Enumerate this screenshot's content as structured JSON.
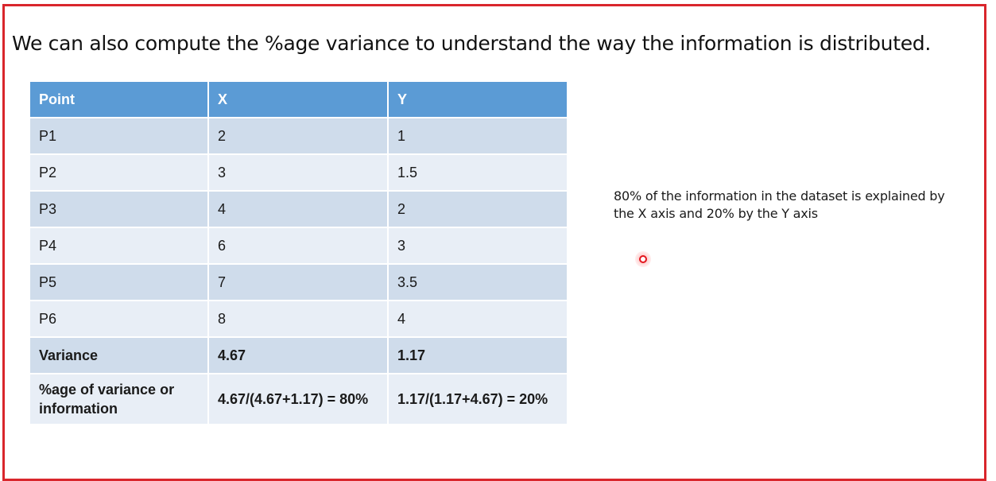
{
  "headline": "We can also compute the %age variance to understand the way the information is distributed.",
  "table": {
    "headers": [
      "Point",
      "X",
      "Y"
    ],
    "rows": [
      [
        "P1",
        "2",
        "1"
      ],
      [
        "P2",
        "3",
        "1.5"
      ],
      [
        "P3",
        "4",
        "2"
      ],
      [
        "P4",
        "6",
        "3"
      ],
      [
        "P5",
        "7",
        "3.5"
      ],
      [
        "P6",
        "8",
        "4"
      ],
      [
        "Variance",
        "4.67",
        "1.17"
      ],
      [
        "%age of variance or information",
        "4.67/(4.67+1.17) = 80%",
        "1.17/(1.17+4.67) = 20%"
      ]
    ]
  },
  "note": "80% of the information in the dataset is explained by the X axis and 20% by the Y axis",
  "colors": {
    "frame_border": "#d9262c",
    "header_bg": "#5b9bd5",
    "row_dark": "#cfdceb",
    "row_light": "#e8eef6",
    "pointer": "#e3161d"
  }
}
